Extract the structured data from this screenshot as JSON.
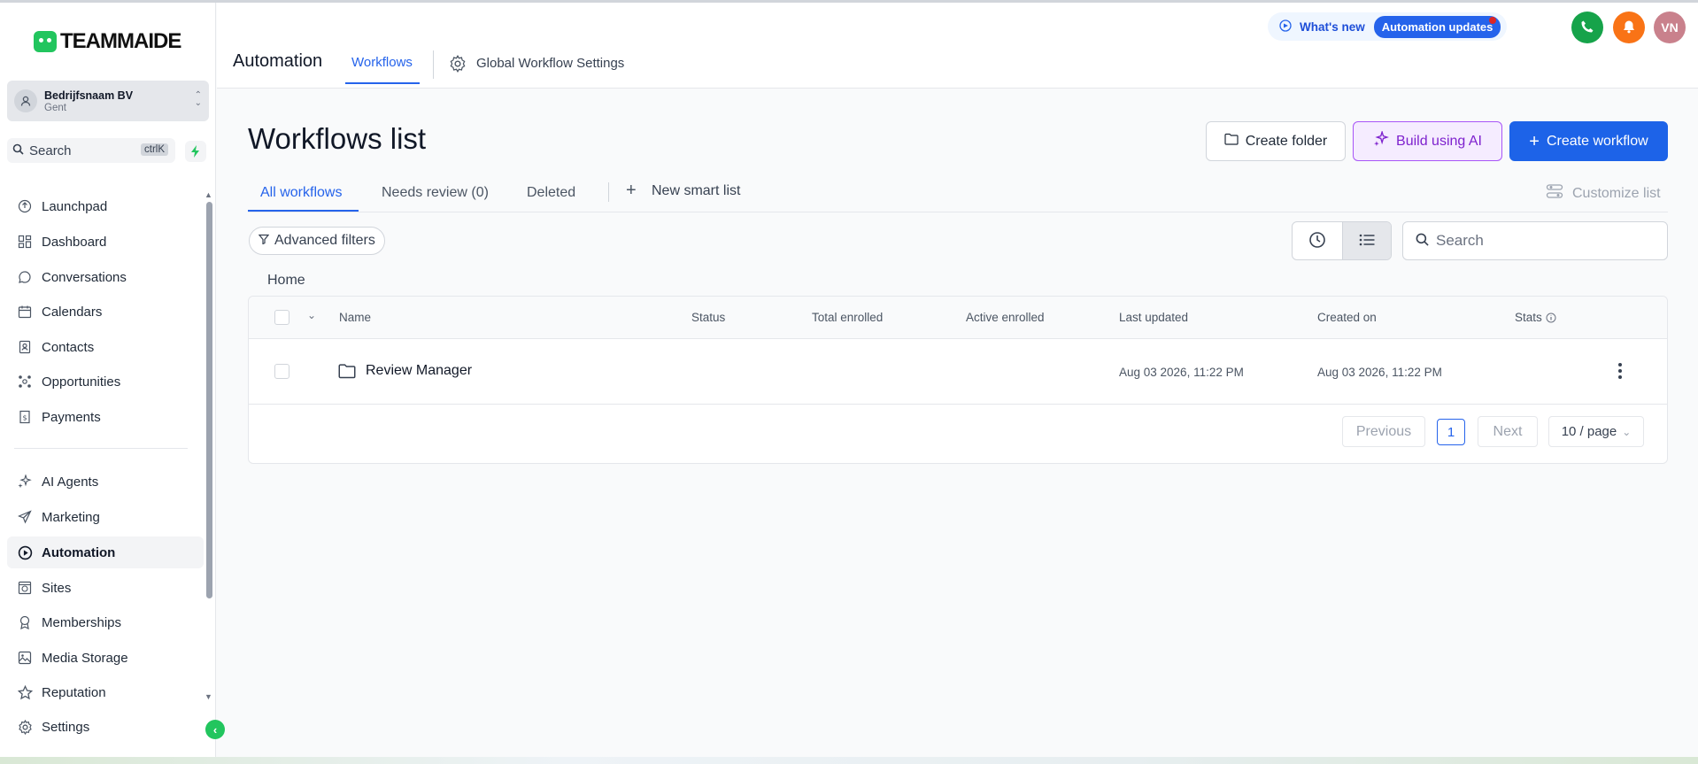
{
  "brand": {
    "logo_text": "TEAMMAIDE",
    "accent": "#22c55e",
    "primary": "#1d63e8"
  },
  "account": {
    "name": "Bedrijfsnaam BV",
    "location": "Gent"
  },
  "sidebar": {
    "search_placeholder": "Search",
    "search_shortcut": "ctrlK",
    "items": [
      {
        "label": "Launchpad",
        "icon": "rocket-icon"
      },
      {
        "label": "Dashboard",
        "icon": "grid-icon"
      },
      {
        "label": "Conversations",
        "icon": "chat-icon"
      },
      {
        "label": "Calendars",
        "icon": "calendar-icon"
      },
      {
        "label": "Contacts",
        "icon": "contacts-icon"
      },
      {
        "label": "Opportunities",
        "icon": "network-icon"
      },
      {
        "label": "Payments",
        "icon": "receipt-icon"
      },
      {
        "label": "AI Agents",
        "icon": "sparkle-icon"
      },
      {
        "label": "Marketing",
        "icon": "send-icon"
      },
      {
        "label": "Automation",
        "icon": "automation-icon",
        "active": true
      },
      {
        "label": "Sites",
        "icon": "globe-icon"
      },
      {
        "label": "Memberships",
        "icon": "award-icon"
      },
      {
        "label": "Media Storage",
        "icon": "image-icon"
      },
      {
        "label": "Reputation",
        "icon": "star-icon"
      },
      {
        "label": "Settings",
        "icon": "gear-icon"
      }
    ]
  },
  "header": {
    "title": "Automation",
    "tab": "Workflows",
    "settings_link": "Global Workflow Settings",
    "whats_new": "What's new",
    "updates_badge": "Automation updates",
    "avatar_initials": "VN"
  },
  "main": {
    "title": "Workflows list",
    "buttons": {
      "create_folder": "Create folder",
      "build_ai": "Build using AI",
      "create_workflow": "Create workflow"
    },
    "tabs": {
      "all": "All workflows",
      "review": "Needs review (0)",
      "deleted": "Deleted",
      "smart_list": "New smart list"
    },
    "customize": "Customize list",
    "advanced_filters": "Advanced filters",
    "search_placeholder": "Search",
    "breadcrumb": "Home",
    "table": {
      "columns": {
        "name": "Name",
        "status": "Status",
        "total": "Total enrolled",
        "active": "Active enrolled",
        "updated": "Last updated",
        "created": "Created on",
        "stats": "Stats"
      },
      "rows": [
        {
          "name": "Review Manager",
          "status": "",
          "total": "",
          "active": "",
          "updated": "Aug 03 2026, 11:22 PM",
          "created": "Aug 03 2026, 11:22 PM"
        }
      ]
    },
    "pagination": {
      "previous": "Previous",
      "page": "1",
      "next": "Next",
      "page_size": "10 / page"
    }
  }
}
